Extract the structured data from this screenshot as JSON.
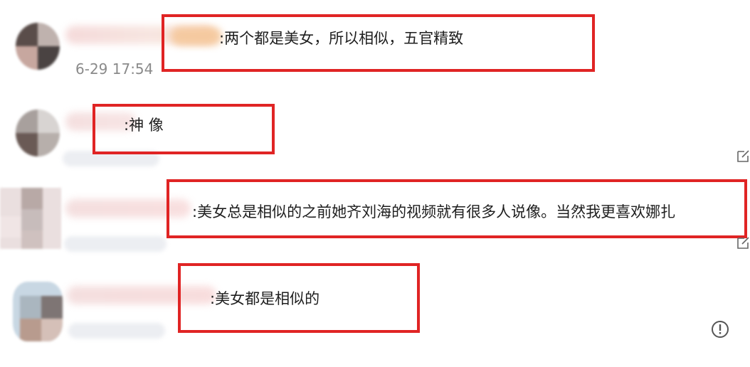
{
  "comments": [
    {
      "text": ":两个都是美女，所以相似，五官精致",
      "timestamp": "6-29 17:54"
    },
    {
      "text": ":神 像"
    },
    {
      "text": ":美女总是相似的之前她齐刘海的视频就有很多人说像。当然我更喜欢娜扎"
    },
    {
      "text": ":美女都是相似的"
    }
  ],
  "icons": {
    "reply": "edit-reply-icon",
    "report": "exclamation-circle-icon"
  },
  "colors": {
    "highlight": "#e02424",
    "timestamp": "#8a8a8a",
    "text": "#1e1e1e"
  }
}
